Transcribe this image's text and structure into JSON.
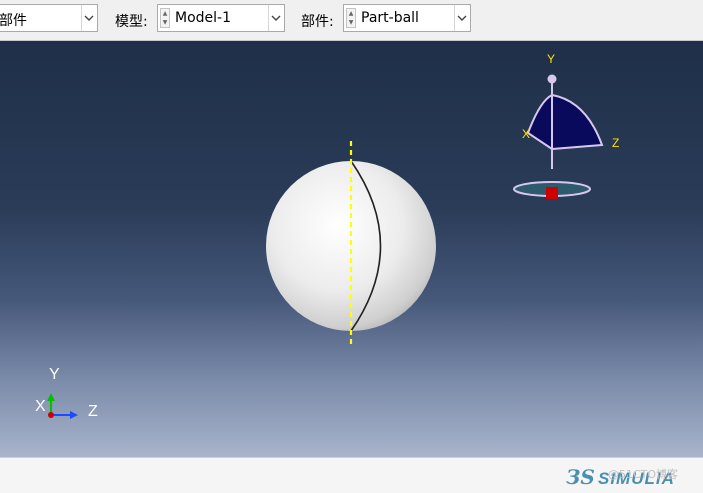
{
  "toolbar": {
    "module_value": "部件",
    "model_label": "模型:",
    "model_value": "Model-1",
    "part_label": "部件:",
    "part_value": "Part-ball"
  },
  "viewport": {
    "background_top": "#1f2f49",
    "background_bottom": "#a8b4cb",
    "triad": {
      "y": "Y",
      "x": "X",
      "z": "Z"
    },
    "view_cube": {
      "y": "Y",
      "x": "X",
      "z": "Z"
    }
  },
  "colors": {
    "axis_line": "#ffff00",
    "sphere": "#e8e8e8",
    "view_cube_fill": "#0a0a5c",
    "view_cube_edge": "#d8c8f0",
    "view_cube_center": "#cc0000",
    "brand": "#4a8fb0"
  },
  "icons": [
    "chevron-down-icon",
    "spinner-icon",
    "triad-icon",
    "view-cube-icon",
    "simulia-logo-icon"
  ],
  "status": {
    "brand_name": "SIMULIA",
    "watermark": "@51CTO博客"
  }
}
